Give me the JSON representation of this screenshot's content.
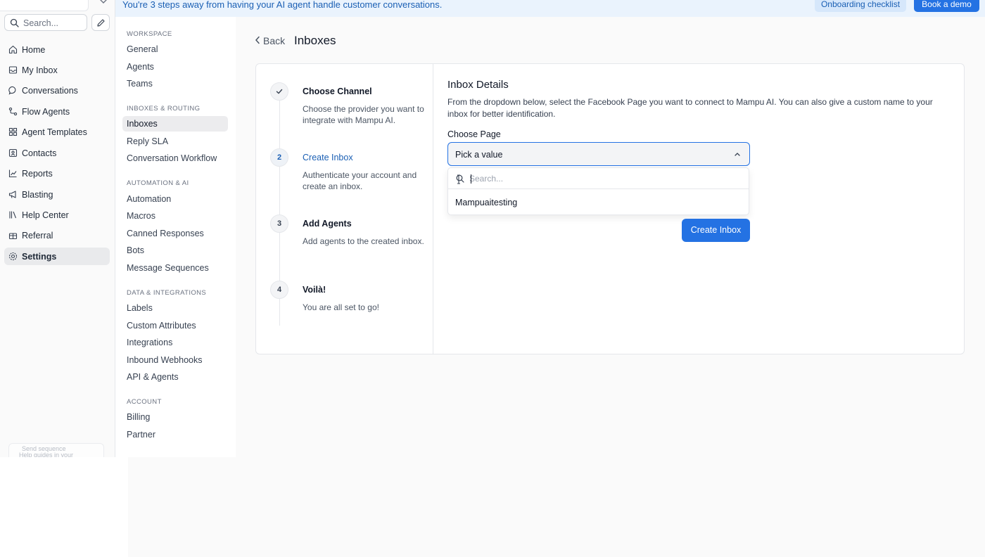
{
  "banner": {
    "text": "You're 3 steps away from having your AI agent handle customer conversations.",
    "checklist_label": "Onboarding checklist",
    "demo_label": "Book a demo"
  },
  "sidebar": {
    "search_placeholder": "Search...",
    "items": [
      {
        "label": "Home",
        "icon": "home-icon"
      },
      {
        "label": "My Inbox",
        "icon": "inbox-icon"
      },
      {
        "label": "Conversations",
        "icon": "chat-bubble-icon"
      },
      {
        "label": "Flow Agents",
        "icon": "flow-icon"
      },
      {
        "label": "Agent Templates",
        "icon": "grid-icon"
      },
      {
        "label": "Contacts",
        "icon": "contact-card-icon"
      },
      {
        "label": "Reports",
        "icon": "trend-chart-icon"
      },
      {
        "label": "Blasting",
        "icon": "megaphone-icon"
      },
      {
        "label": "Help Center",
        "icon": "book-icon"
      },
      {
        "label": "Referral",
        "icon": "gift-icon"
      },
      {
        "label": "Settings",
        "icon": "gear-icon",
        "active": true
      }
    ]
  },
  "settings_nav": {
    "sections": [
      {
        "heading": "WORKSPACE",
        "items": [
          "General",
          "Agents",
          "Teams"
        ]
      },
      {
        "heading": "INBOXES & ROUTING",
        "items": [
          "Inboxes",
          "Reply SLA",
          "Conversation Workflow"
        ]
      },
      {
        "heading": "AUTOMATION & AI",
        "items": [
          "Automation",
          "Macros",
          "Canned Responses",
          "Bots",
          "Message Sequences"
        ]
      },
      {
        "heading": "DATA & INTEGRATIONS",
        "items": [
          "Labels",
          "Custom Attributes",
          "Integrations",
          "Inbound Webhooks",
          "API & Agents"
        ]
      },
      {
        "heading": "ACCOUNT",
        "items": [
          "Billing",
          "Partner"
        ]
      }
    ],
    "active": "Inboxes"
  },
  "header": {
    "back_label": "Back",
    "title": "Inboxes"
  },
  "steps": [
    {
      "marker": "",
      "title": "Choose Channel",
      "desc": "Choose the provider you want to integrate with Mampu AI.",
      "state": "done"
    },
    {
      "marker": "2",
      "title": "Create Inbox",
      "desc": "Authenticate your account and create an inbox.",
      "state": "current"
    },
    {
      "marker": "3",
      "title": "Add Agents",
      "desc": "Add agents to the created inbox.",
      "state": "pending"
    },
    {
      "marker": "4",
      "title": "Voilà!",
      "desc": "You are all set to go!",
      "state": "pending"
    }
  ],
  "details": {
    "title": "Inbox Details",
    "description": "From the dropdown below, select the Facebook Page you want to connect to Mampu AI. You can also give a custom name to your inbox for better identification.",
    "field_label": "Choose Page",
    "select_value": "Pick a value",
    "dropdown_search_placeholder": "Search...",
    "options": [
      "Mampuaitesting"
    ],
    "submit_label": "Create Inbox"
  },
  "ghost": {
    "line1": "Send sequence",
    "line2": "Help guides in your"
  },
  "colors": {
    "accent": "#2472e3",
    "banner_bg": "#eaf3fd",
    "banner_text": "#1a5fb4"
  }
}
